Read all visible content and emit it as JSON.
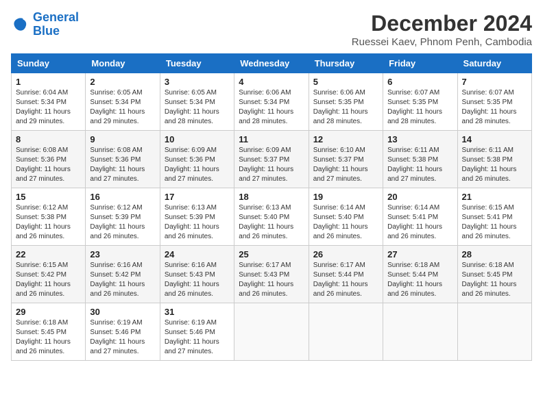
{
  "logo": {
    "line1": "General",
    "line2": "Blue"
  },
  "title": "December 2024",
  "location": "Ruessei Kaev, Phnom Penh, Cambodia",
  "days_of_week": [
    "Sunday",
    "Monday",
    "Tuesday",
    "Wednesday",
    "Thursday",
    "Friday",
    "Saturday"
  ],
  "weeks": [
    [
      {
        "day": "1",
        "sunrise": "6:04 AM",
        "sunset": "5:34 PM",
        "daylight": "11 hours and 29 minutes."
      },
      {
        "day": "2",
        "sunrise": "6:05 AM",
        "sunset": "5:34 PM",
        "daylight": "11 hours and 29 minutes."
      },
      {
        "day": "3",
        "sunrise": "6:05 AM",
        "sunset": "5:34 PM",
        "daylight": "11 hours and 28 minutes."
      },
      {
        "day": "4",
        "sunrise": "6:06 AM",
        "sunset": "5:34 PM",
        "daylight": "11 hours and 28 minutes."
      },
      {
        "day": "5",
        "sunrise": "6:06 AM",
        "sunset": "5:35 PM",
        "daylight": "11 hours and 28 minutes."
      },
      {
        "day": "6",
        "sunrise": "6:07 AM",
        "sunset": "5:35 PM",
        "daylight": "11 hours and 28 minutes."
      },
      {
        "day": "7",
        "sunrise": "6:07 AM",
        "sunset": "5:35 PM",
        "daylight": "11 hours and 28 minutes."
      }
    ],
    [
      {
        "day": "8",
        "sunrise": "6:08 AM",
        "sunset": "5:36 PM",
        "daylight": "11 hours and 27 minutes."
      },
      {
        "day": "9",
        "sunrise": "6:08 AM",
        "sunset": "5:36 PM",
        "daylight": "11 hours and 27 minutes."
      },
      {
        "day": "10",
        "sunrise": "6:09 AM",
        "sunset": "5:36 PM",
        "daylight": "11 hours and 27 minutes."
      },
      {
        "day": "11",
        "sunrise": "6:09 AM",
        "sunset": "5:37 PM",
        "daylight": "11 hours and 27 minutes."
      },
      {
        "day": "12",
        "sunrise": "6:10 AM",
        "sunset": "5:37 PM",
        "daylight": "11 hours and 27 minutes."
      },
      {
        "day": "13",
        "sunrise": "6:11 AM",
        "sunset": "5:38 PM",
        "daylight": "11 hours and 27 minutes."
      },
      {
        "day": "14",
        "sunrise": "6:11 AM",
        "sunset": "5:38 PM",
        "daylight": "11 hours and 26 minutes."
      }
    ],
    [
      {
        "day": "15",
        "sunrise": "6:12 AM",
        "sunset": "5:38 PM",
        "daylight": "11 hours and 26 minutes."
      },
      {
        "day": "16",
        "sunrise": "6:12 AM",
        "sunset": "5:39 PM",
        "daylight": "11 hours and 26 minutes."
      },
      {
        "day": "17",
        "sunrise": "6:13 AM",
        "sunset": "5:39 PM",
        "daylight": "11 hours and 26 minutes."
      },
      {
        "day": "18",
        "sunrise": "6:13 AM",
        "sunset": "5:40 PM",
        "daylight": "11 hours and 26 minutes."
      },
      {
        "day": "19",
        "sunrise": "6:14 AM",
        "sunset": "5:40 PM",
        "daylight": "11 hours and 26 minutes."
      },
      {
        "day": "20",
        "sunrise": "6:14 AM",
        "sunset": "5:41 PM",
        "daylight": "11 hours and 26 minutes."
      },
      {
        "day": "21",
        "sunrise": "6:15 AM",
        "sunset": "5:41 PM",
        "daylight": "11 hours and 26 minutes."
      }
    ],
    [
      {
        "day": "22",
        "sunrise": "6:15 AM",
        "sunset": "5:42 PM",
        "daylight": "11 hours and 26 minutes."
      },
      {
        "day": "23",
        "sunrise": "6:16 AM",
        "sunset": "5:42 PM",
        "daylight": "11 hours and 26 minutes."
      },
      {
        "day": "24",
        "sunrise": "6:16 AM",
        "sunset": "5:43 PM",
        "daylight": "11 hours and 26 minutes."
      },
      {
        "day": "25",
        "sunrise": "6:17 AM",
        "sunset": "5:43 PM",
        "daylight": "11 hours and 26 minutes."
      },
      {
        "day": "26",
        "sunrise": "6:17 AM",
        "sunset": "5:44 PM",
        "daylight": "11 hours and 26 minutes."
      },
      {
        "day": "27",
        "sunrise": "6:18 AM",
        "sunset": "5:44 PM",
        "daylight": "11 hours and 26 minutes."
      },
      {
        "day": "28",
        "sunrise": "6:18 AM",
        "sunset": "5:45 PM",
        "daylight": "11 hours and 26 minutes."
      }
    ],
    [
      {
        "day": "29",
        "sunrise": "6:18 AM",
        "sunset": "5:45 PM",
        "daylight": "11 hours and 26 minutes."
      },
      {
        "day": "30",
        "sunrise": "6:19 AM",
        "sunset": "5:46 PM",
        "daylight": "11 hours and 27 minutes."
      },
      {
        "day": "31",
        "sunrise": "6:19 AM",
        "sunset": "5:46 PM",
        "daylight": "11 hours and 27 minutes."
      },
      null,
      null,
      null,
      null
    ]
  ]
}
